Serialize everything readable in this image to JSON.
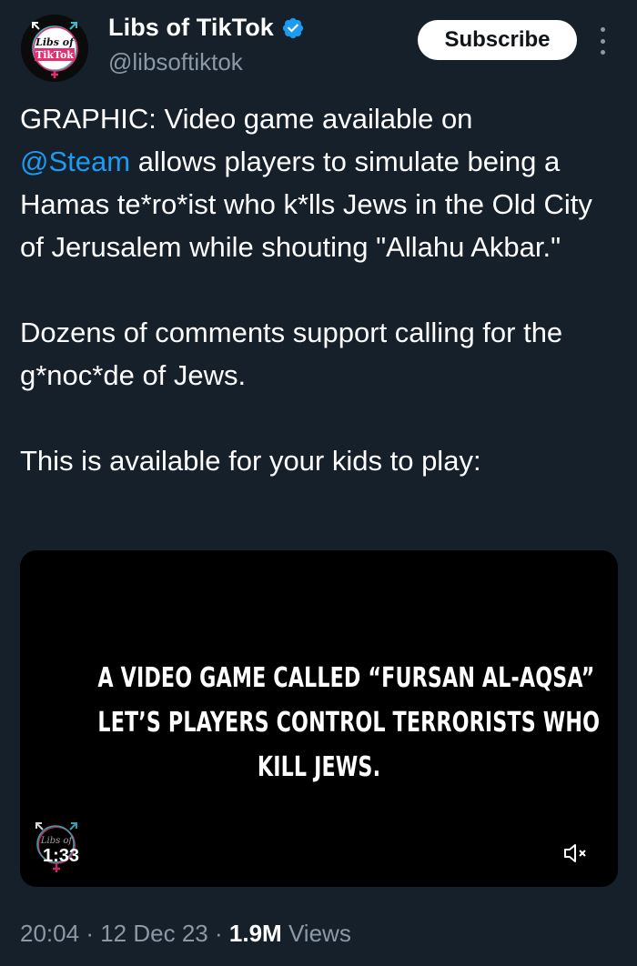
{
  "author": {
    "display_name": "Libs of TikTok",
    "handle": "@libsoftiktok",
    "avatar_text_line1": "Libs of",
    "avatar_text_line2": "TikTok",
    "verified": true
  },
  "header": {
    "subscribe_label": "Subscribe",
    "more_icon": "more-vertical-icon"
  },
  "tweet": {
    "para1_start": "GRAPHIC: Video game available on",
    "mention": "@Steam",
    "para1_rest": " allows players to simulate being a Hamas te*ro*ist who k*lls Jews in the Old City of Jerusalem while shouting \"Allahu Akbar.\"",
    "para2": "Dozens of comments support calling for the g*noc*de of Jews.",
    "para3": "This is available for your kids to play:"
  },
  "video": {
    "caption_line1": "A VIDEO GAME CALLED “FURSAN AL-AQSA”",
    "caption_line2": "LET’S PLAYERS CONTROL TERRORISTS WHO",
    "caption_line3": "KILL JEWS.",
    "watermark_text": "Libs of",
    "duration": "1:33",
    "mute_icon": "volume-muted-icon"
  },
  "meta": {
    "time": "20:04",
    "separator": "·",
    "date": "12 Dec 23",
    "views_count": "1.9M",
    "views_label": "Views"
  },
  "colors": {
    "background": "#15202b",
    "text": "#ffffff",
    "secondary_text": "#8b98a5",
    "link": "#1d9bf0",
    "verified_badge": "#1d9bf0",
    "avatar_pink": "#e0306f",
    "avatar_teal": "#35c1c5"
  }
}
